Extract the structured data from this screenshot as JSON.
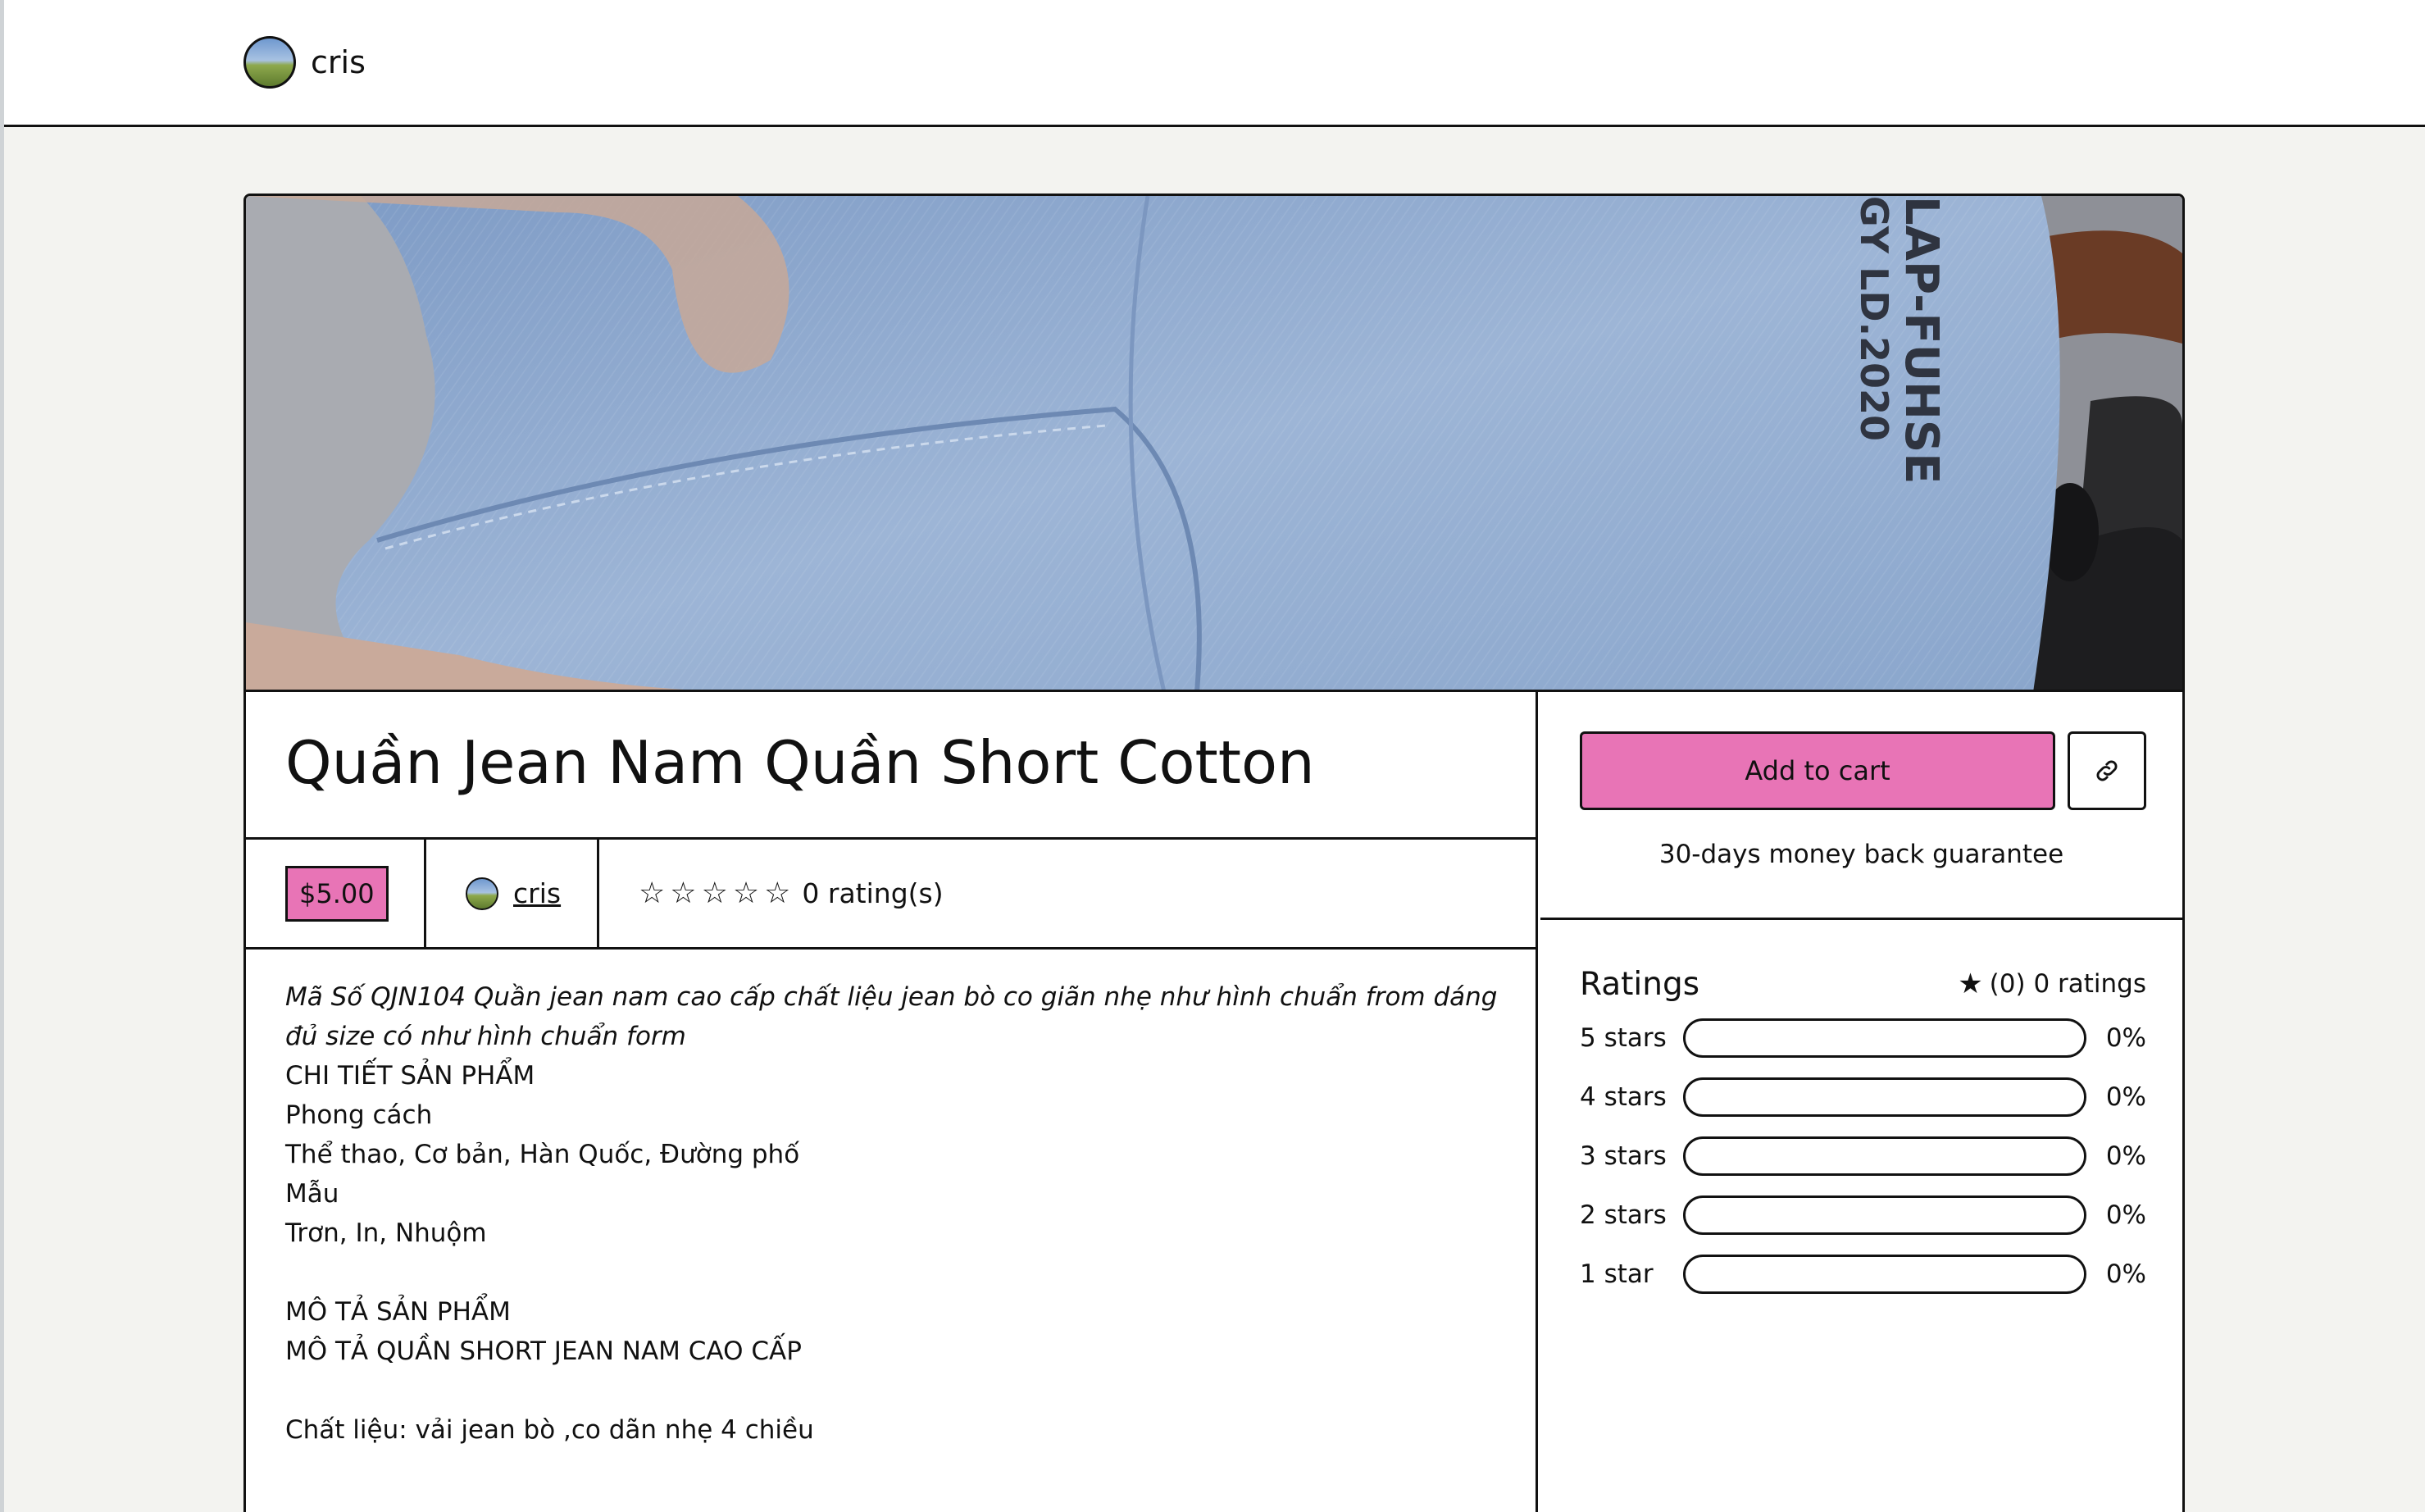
{
  "header": {
    "store_name": "cris"
  },
  "product": {
    "title": "Quần Jean Nam Quần Short Cotton",
    "price": "$5.00",
    "seller": "cris",
    "rating_count_label": "0 rating(s)",
    "stars_filled": 0,
    "stars_total": 5,
    "description": {
      "intro": "Mã Số QJN104 Quần jean nam cao cấp chất liệu jean bò co giãn nhẹ như hình chuẩn from dáng đủ size có như hình chuẩn form",
      "lines_1": [
        "CHI TIẾT SẢN PHẨM",
        "Phong cách",
        "Thể thao, Cơ bản, Hàn Quốc, Đường phố",
        "Mẫu",
        "Trơn, In, Nhuộm"
      ],
      "lines_2": [
        "MÔ TẢ SẢN PHẨM",
        "MÔ TẢ QUẦN SHORT JEAN NAM CAO CẤP"
      ],
      "lines_3": [
        "Chất liệu: vải jean bò ,co dãn nhẹ 4 chiều"
      ]
    }
  },
  "purchase": {
    "add_to_cart_label": "Add to cart",
    "copy_link_icon": "link-icon",
    "guarantee": "30-days money back guarantee"
  },
  "ratings": {
    "title": "Ratings",
    "summary": "(0) 0 ratings",
    "rows": [
      {
        "label": "5 stars",
        "percent": "0%",
        "fraction": 0
      },
      {
        "label": "4 stars",
        "percent": "0%",
        "fraction": 0
      },
      {
        "label": "3 stars",
        "percent": "0%",
        "fraction": 0
      },
      {
        "label": "2 stars",
        "percent": "0%",
        "fraction": 0
      },
      {
        "label": "1 star",
        "percent": "0%",
        "fraction": 0
      }
    ]
  },
  "hero_image": {
    "print_text": [
      "LAP-FUHSE",
      "GY LD.2020"
    ]
  },
  "colors": {
    "accent": "#e874b6",
    "border": "#111111",
    "page_bg": "#f3f3f0"
  }
}
